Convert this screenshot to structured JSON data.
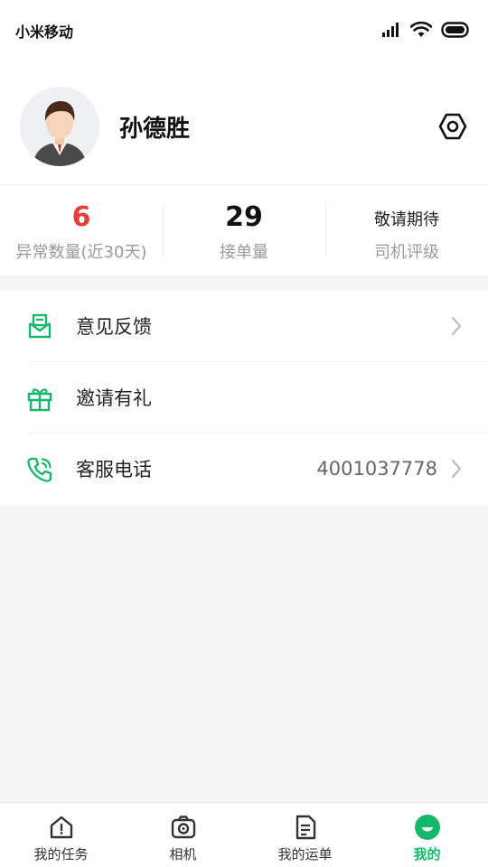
{
  "status_bar": {
    "carrier": "小米移动",
    "icons": [
      "signal-icon",
      "wifi-icon",
      "battery-icon"
    ]
  },
  "profile": {
    "name": "孙德胜",
    "avatar": "avatar-icon",
    "settings_icon": "settings-icon"
  },
  "stats": [
    {
      "value": "6",
      "label": "异常数量(近30天)",
      "color": "#e23f3a"
    },
    {
      "value": "29",
      "label": "接单量",
      "color": "#111111"
    },
    {
      "value": "敬请期待",
      "label": "司机评级",
      "color": "#222222"
    }
  ],
  "menu": [
    {
      "label": "意见反馈",
      "icon": "feedback-mail-icon",
      "value": "",
      "chevron": true
    },
    {
      "label": "邀请有礼",
      "icon": "gift-icon",
      "value": "",
      "chevron": false
    },
    {
      "label": "客服电话",
      "icon": "phone-icon",
      "value": "4001037778",
      "chevron": true
    }
  ],
  "tabbar": [
    {
      "label": "我的任务",
      "icon": "home-task-icon",
      "active": false
    },
    {
      "label": "相机",
      "icon": "camera-icon",
      "active": false
    },
    {
      "label": "我的运单",
      "icon": "document-icon",
      "active": false
    },
    {
      "label": "我的",
      "icon": "profile-smile-icon",
      "active": true
    }
  ],
  "colors": {
    "accent": "#14b86a",
    "alert": "#e23f3a",
    "background": "#f5f5f5"
  }
}
